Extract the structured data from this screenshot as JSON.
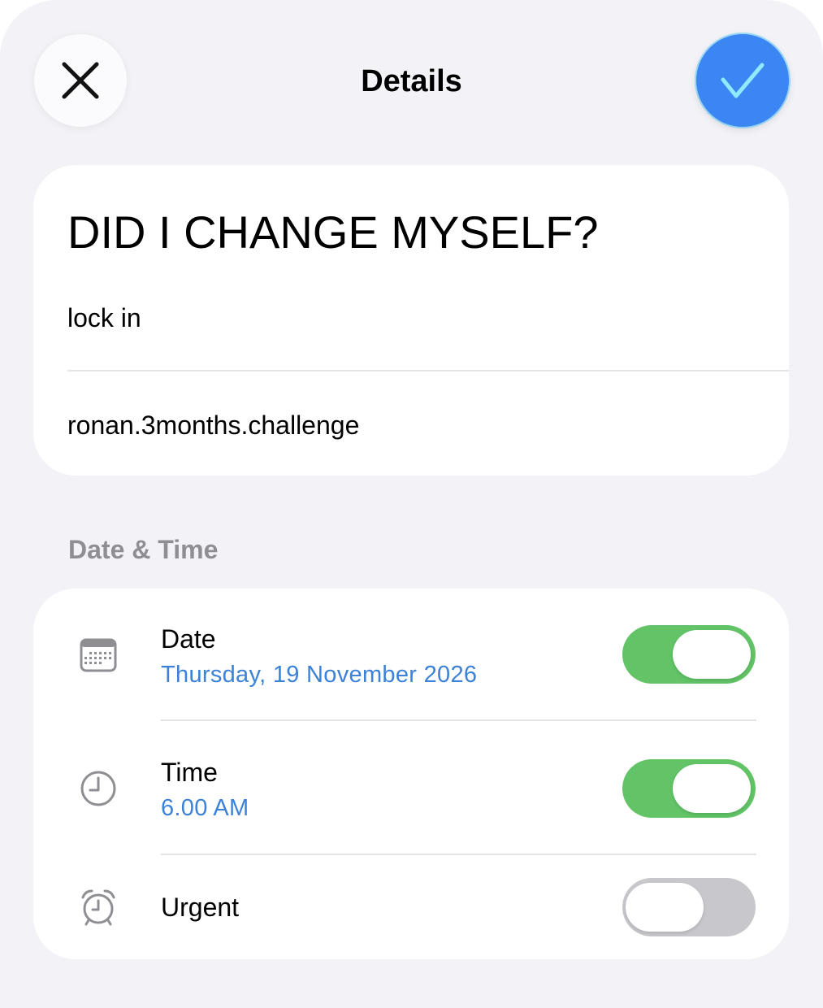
{
  "header": {
    "title": "Details",
    "close_icon": "close-icon",
    "confirm_icon": "checkmark-icon",
    "confirm_color": "#3b86f2"
  },
  "task": {
    "title": "DID I CHANGE MYSELF?",
    "notes": "lock in",
    "url": "ronan.3months.challenge"
  },
  "date_time": {
    "section_title": "Date & Time",
    "rows": [
      {
        "icon": "calendar-icon",
        "label": "Date",
        "value": "Thursday, 19 November 2026",
        "enabled": true
      },
      {
        "icon": "clock-icon",
        "label": "Time",
        "value": "6.00 AM",
        "enabled": true
      },
      {
        "icon": "alarm-icon",
        "label": "Urgent",
        "value": "",
        "enabled": false
      }
    ]
  },
  "colors": {
    "toggle_on": "#62c466",
    "toggle_off": "#c7c7cc",
    "accent_text": "#3b82d8",
    "background": "#f2f2f7"
  }
}
